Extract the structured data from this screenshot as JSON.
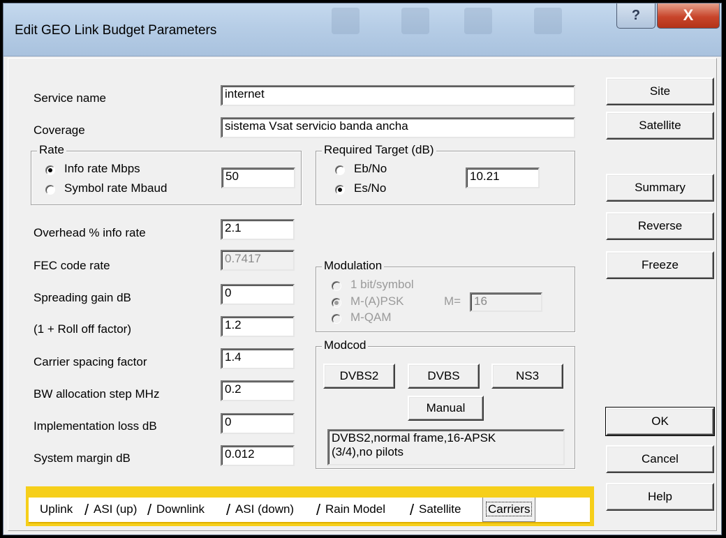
{
  "window": {
    "title": "Edit GEO Link Budget Parameters",
    "help_glyph": "?",
    "close_glyph": "X"
  },
  "fields": {
    "service_name": {
      "label": "Service name",
      "value": "internet"
    },
    "coverage": {
      "label": "Coverage",
      "value": "sistema Vsat servicio banda ancha"
    },
    "overhead": {
      "label": "Overhead % info rate",
      "value": "2.1"
    },
    "fec": {
      "label": "FEC code rate",
      "value": "0.7417"
    },
    "spreading": {
      "label": "Spreading gain dB",
      "value": "0"
    },
    "rolloff": {
      "label": "(1 + Roll off factor)",
      "value": "1.2"
    },
    "carrier_spacing": {
      "label": "Carrier spacing factor",
      "value": "1.4"
    },
    "bw_step": {
      "label": "BW allocation step MHz",
      "value": "0.2"
    },
    "impl_loss": {
      "label": "Implementation loss dB",
      "value": "0"
    },
    "sys_margin": {
      "label": "System margin dB",
      "value": "0.012"
    }
  },
  "rate": {
    "title": "Rate",
    "info_rate": "Info rate Mbps",
    "symbol_rate": "Symbol rate Mbaud",
    "value": "50",
    "selected": "info_rate"
  },
  "target": {
    "title": "Required Target (dB)",
    "ebno": "Eb/No",
    "esno": "Es/No",
    "value": "10.21",
    "selected": "esno"
  },
  "modulation": {
    "title": "Modulation",
    "opt1": "1 bit/symbol",
    "opt2": "M-(A)PSK",
    "opt3": "M-QAM",
    "m_label": "M=",
    "m_value": "16",
    "selected": "opt2"
  },
  "modcod": {
    "title": "Modcod",
    "dvbs2": "DVBS2",
    "dvbs": "DVBS",
    "ns3": "NS3",
    "manual": "Manual",
    "description_line1": "DVBS2,normal frame,16-APSK",
    "description_line2": "(3/4),no pilots"
  },
  "side_buttons": {
    "site": "Site",
    "satellite": "Satellite",
    "summary": "Summary",
    "reverse": "Reverse",
    "freeze": "Freeze",
    "ok": "OK",
    "cancel": "Cancel",
    "help": "Help"
  },
  "tabs": [
    "Uplink",
    "ASI (up)",
    "Downlink",
    "ASI (down)",
    "Rain Model",
    "Satellite",
    "Carriers"
  ],
  "selected_tab": "Carriers",
  "colors": {
    "tab_strip": "#f6cf1a",
    "title_gradient": "#b6cde6",
    "close_button": "#c8452b"
  }
}
